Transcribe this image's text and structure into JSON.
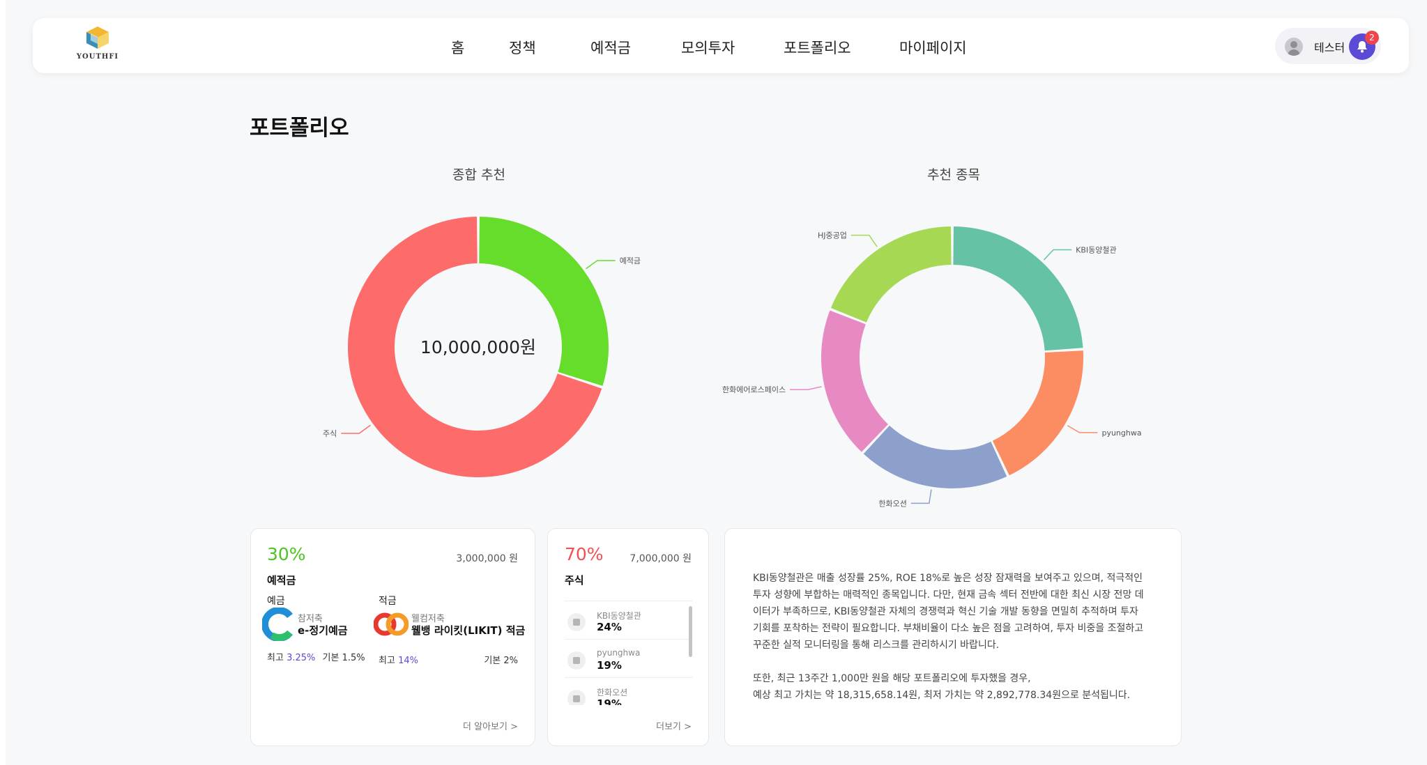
{
  "logo": {
    "text": "YOUTHFI",
    "icon": "cube-logo-icon"
  },
  "nav": {
    "items": [
      {
        "label": "홈"
      },
      {
        "label": "정책"
      },
      {
        "label": "예적금"
      },
      {
        "label": "모의투자"
      },
      {
        "label": "포트폴리오"
      },
      {
        "label": "마이페이지"
      }
    ]
  },
  "user": {
    "name": "테스터",
    "notification_count": "2"
  },
  "page_title": "포트폴리오",
  "chart_data": [
    {
      "type": "pie",
      "title": "종합 추천",
      "center_label": "10,000,000원",
      "labels": [
        "예적금",
        "주식"
      ],
      "values": [
        30,
        70
      ],
      "colors": [
        "#66dc2b",
        "#fd6b6b"
      ]
    },
    {
      "type": "pie",
      "title": "추천 종목",
      "labels": [
        "KBI동양철관",
        "pyunghwa",
        "한화오션",
        "한화에어로스페이스",
        "HJ중공업"
      ],
      "values": [
        24,
        19,
        19,
        19,
        19
      ],
      "colors": [
        "#66c2a5",
        "#fc8d62",
        "#8da0cb",
        "#e78ac3",
        "#a6d854"
      ]
    }
  ],
  "savings_card": {
    "percent": "30%",
    "percent_color": "#4cc51f",
    "amount": "3,000,000 원",
    "label": "예적금",
    "deposit": {
      "type_label": "예금",
      "bank": "참저축",
      "product": "e-정기예금",
      "max_label": "최고",
      "max_rate": "3.25%",
      "base_label": "기본 1.5%"
    },
    "installment": {
      "type_label": "적금",
      "bank": "웰컴저축",
      "product": "웰뱅 라이킷(LIKIT) 적금",
      "max_label": "최고",
      "max_rate": "14%",
      "base_label": "기본 2%"
    },
    "more": "더 알아보기 >"
  },
  "stock_card": {
    "percent": "70%",
    "percent_color": "#f25050",
    "amount": "7,000,000 원",
    "label": "주식",
    "items": [
      {
        "name": "KBI동양철관",
        "pct": "24%"
      },
      {
        "name": "pyunghwa",
        "pct": "19%"
      },
      {
        "name": "한화오션",
        "pct": "19%"
      }
    ],
    "more": "더보기 >"
  },
  "analysis": {
    "paragraph1": "KBI동양철관은 매출 성장률 25%, ROE 18%로 높은 성장 잠재력을 보여주고 있으며, 적극적인 투자 성향에 부합하는 매력적인 종목입니다. 다만, 현재 금속 섹터 전반에 대한 최신 시장 전망 데이터가 부족하므로, KBI동양철관 자체의 경쟁력과 혁신 기술 개발 동향을 면밀히 추적하며 투자 기회를 포착하는 전략이 필요합니다. 부채비율이 다소 높은 점을 고려하여, 투자 비중을 조절하고 꾸준한 실적 모니터링을 통해 리스크를 관리하시기 바랍니다.",
    "paragraph2_line1": "또한, 최근 13주간 1,000만 원을 해당 포트폴리오에 투자했을 경우,",
    "paragraph2_line2": "예상 최고 가치는 약 18,315,658.14원, 최저 가치는 약 2,892,778.34원으로 분석됩니다."
  }
}
